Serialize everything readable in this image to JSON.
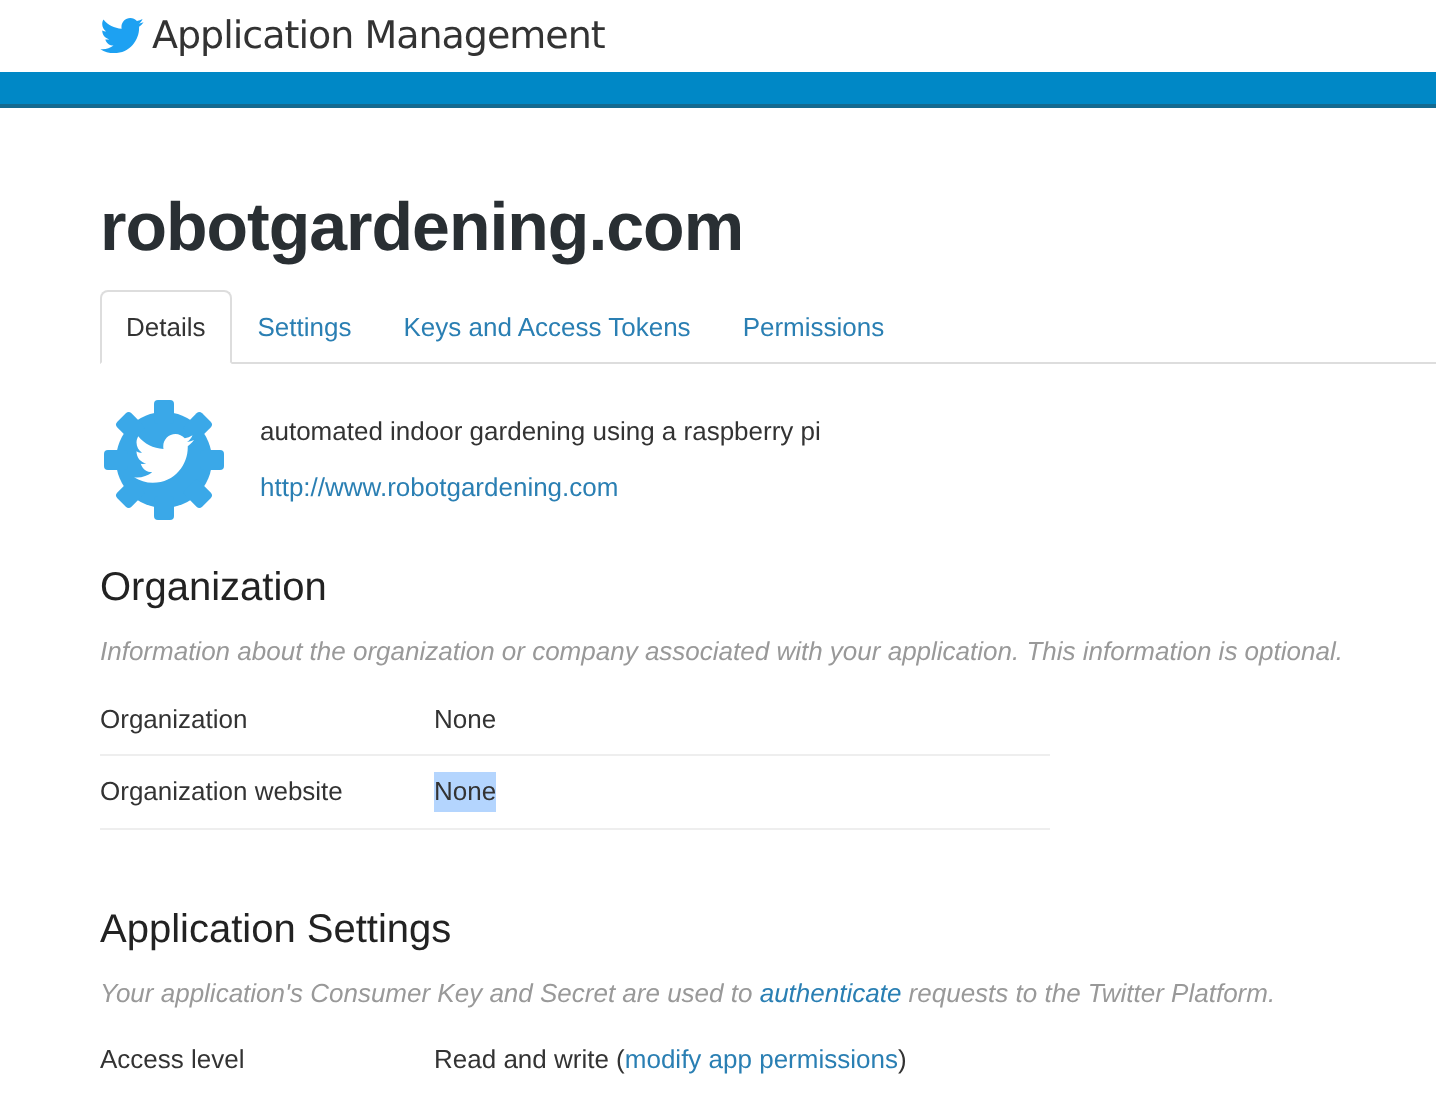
{
  "header": {
    "title": "Application Management"
  },
  "app": {
    "name": "robotgardening.com",
    "description": "automated indoor gardening using a raspberry pi",
    "url": "http://www.robotgardening.com"
  },
  "tabs": [
    {
      "label": "Details",
      "selected": true
    },
    {
      "label": "Settings",
      "selected": false
    },
    {
      "label": "Keys and Access Tokens",
      "selected": false
    },
    {
      "label": "Permissions",
      "selected": false
    }
  ],
  "organization": {
    "heading": "Organization",
    "note": "Information about the organization or company associated with your application. This information is optional.",
    "rows": [
      {
        "label": "Organization",
        "value": "None",
        "highlighted": false
      },
      {
        "label": "Organization website",
        "value": "None",
        "highlighted": true
      }
    ]
  },
  "application_settings": {
    "heading": "Application Settings",
    "note_before": "Your application's Consumer Key and Secret are used to ",
    "note_link": "authenticate",
    "note_after": " requests to the Twitter Platform.",
    "rows": [
      {
        "label": "Access level",
        "value_before": "Read and write (",
        "link": "modify app permissions",
        "value_after": ")"
      }
    ]
  }
}
